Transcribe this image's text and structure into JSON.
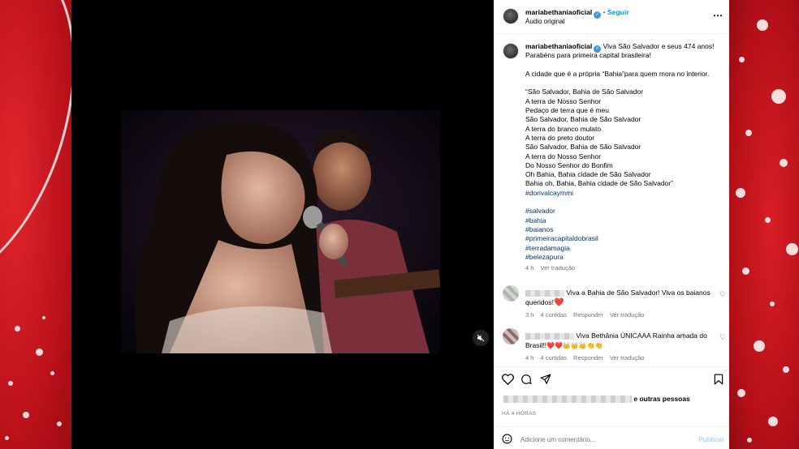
{
  "post": {
    "header": {
      "username": "mariabethaniaoficial",
      "follow_label": "Seguir",
      "audio_label": "Áudio original"
    },
    "caption": {
      "username": "mariabethaniaoficial",
      "lines": [
        "Viva São Salvador e seus 474 anos!",
        "Parabéns para primeira capital brasileira!",
        "",
        "A cidade que é a própria “Bahia”para quem mora no interior.",
        "",
        "“São Salvador, Bahia de São Salvador",
        "A terra de Nosso Senhor",
        "Pedaço de terra que é meu",
        "São Salvador, Bahia de São Salvador",
        "A terra do branco mulato",
        "A terra do preto doutor",
        "São Salvador, Bahia de São Salvador",
        "A terra do Nosso Senhor",
        "Do Nosso Senhor do Bonfim",
        "Oh Bahia, Bahia cidade de São Salvador",
        "Bahia oh, Bahia, Bahia cidade de São Salvador”"
      ],
      "hashtags": [
        "#dorivalcaymmi",
        "",
        "#salvador",
        "#bahia",
        "#baianos",
        "#primeiracapitaldobrasil",
        "#terradamagia",
        "#belezapura"
      ],
      "time": "4 h",
      "translate": "Ver tradução"
    },
    "comments": [
      {
        "text_line1": "Viva a Bahia de São Salvador! Viva os baianos",
        "text_line2": "queridos!",
        "emoji": "❤️",
        "time": "3 h",
        "likes": "4 curtidas",
        "reply": "Responder",
        "translate": "Ver tradução"
      },
      {
        "text_line1": "Viva Bethânia ÚNICAAA Rainha amada do",
        "text_line2": "Brasil!!",
        "emoji": "❤️❤️👑👑👑👏👏",
        "time": "4 h",
        "likes": "4 curtidas",
        "reply": "Responder",
        "translate": "Ver tradução"
      }
    ],
    "likes_suffix": "e outras pessoas",
    "timestamp": "HÁ 4 HORAS",
    "comment_input": {
      "placeholder": "Adicione um comentário...",
      "publish_label": "Publicar"
    }
  },
  "colors": {
    "accent_blue": "#0095f6",
    "background_red": "#c8141c",
    "heart_red": "#ed4956"
  },
  "icons": {
    "more": "more-icon",
    "heart": "heart-icon",
    "comment": "comment-icon",
    "share": "share-icon",
    "save": "bookmark-icon",
    "emoji": "emoji-icon",
    "mute": "muted-speaker-icon"
  }
}
